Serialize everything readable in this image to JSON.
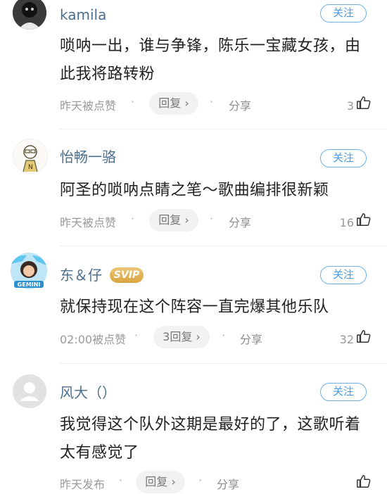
{
  "comments": [
    {
      "username": "kamila",
      "follow_label": "关注",
      "text": "唢呐一出，谁与争锋，陈乐一宝藏女孩，由此我将路转粉",
      "meta": "昨天被点赞",
      "dot": "·",
      "reply_label": "回复 ›",
      "share_label": "分享",
      "like_count": "3",
      "avatar_icon": "avatar-dark-icon"
    },
    {
      "username": "怡畅一骆",
      "follow_label": "关注",
      "text": "阿圣的唢呐点睛之笔～歌曲编排很新颖",
      "meta": "昨天被点赞",
      "dot": "·",
      "reply_label": "回复 ›",
      "share_label": "分享",
      "like_count": "16",
      "avatar_icon": "avatar-sketch-icon"
    },
    {
      "username": "东＆仔",
      "badge": "SVIP",
      "follow_label": "关注",
      "text": "就保持现在这个阵容一直完爆其他乐队",
      "meta": "02:00被点赞",
      "dot": "·",
      "reply_label": "3回复 ›",
      "share_label": "分享",
      "like_count": "32",
      "avatar_icon": "avatar-gemini-icon"
    },
    {
      "username": "风大（）",
      "follow_label": "关注",
      "text": "我觉得这个队外这期是最好的了，这歌听着太有感觉了",
      "meta": "昨天发布",
      "dot": "·",
      "reply_label": "回复 ›",
      "share_label": "分享",
      "like_count": "",
      "avatar_icon": "avatar-default-icon"
    }
  ],
  "colors": {
    "username": "#4c6f8e",
    "follow": "#4a9ae0",
    "svip": "#d8a43e"
  }
}
